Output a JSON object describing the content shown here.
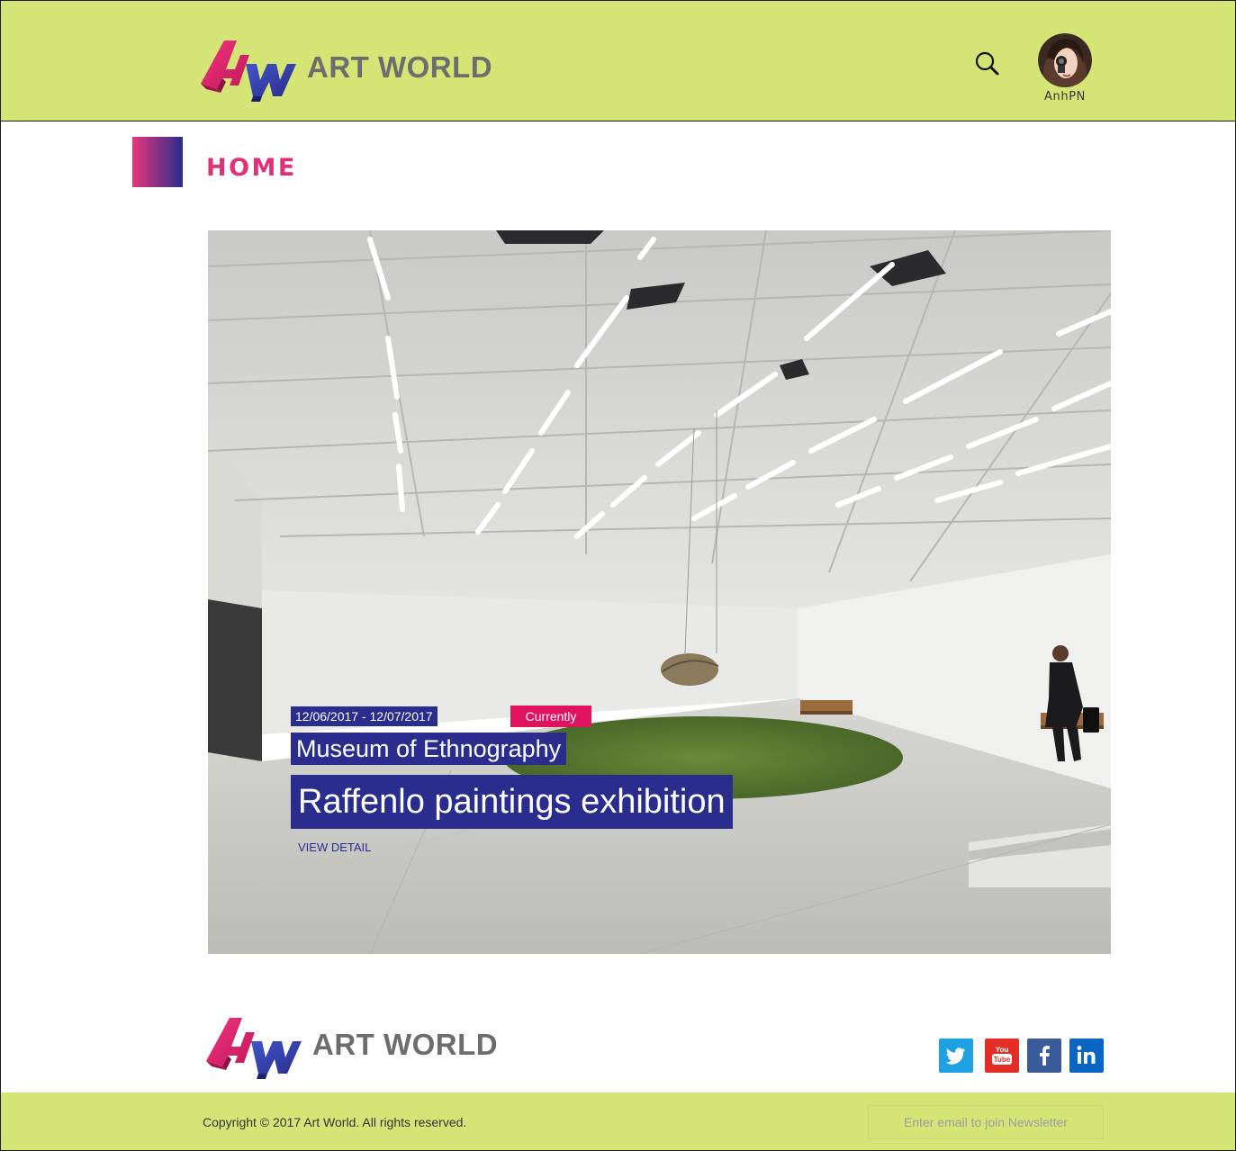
{
  "header": {
    "brand": "ART WORLD",
    "logo_icon": "aw-logo-icon",
    "search_icon": "search-icon",
    "user": {
      "name": "AnhPN",
      "avatar_icon": "avatar-icon"
    }
  },
  "page": {
    "title": "HOME"
  },
  "featured": {
    "date_range": "12/06/2017 - 12/07/2017",
    "status": "Currently",
    "venue": "Museum of Ethnography",
    "title": "Raffenlo paintings exhibition",
    "link_label": "VIEW DETAIL"
  },
  "footer": {
    "brand": "ART WORLD",
    "social": [
      "twitter-icon",
      "youtube-icon",
      "facebook-icon",
      "linkedin-icon"
    ],
    "copyright": "Copyright © 2017 Art World. All rights reserved.",
    "newsletter_placeholder": "Enter email to join Newsletter"
  },
  "colors": {
    "header_bg": "#d4e475",
    "accent_pink": "#e0307a",
    "accent_navy": "#2b2d8e",
    "status_red": "#e0135f",
    "logo_text": "#6d6d6d"
  }
}
